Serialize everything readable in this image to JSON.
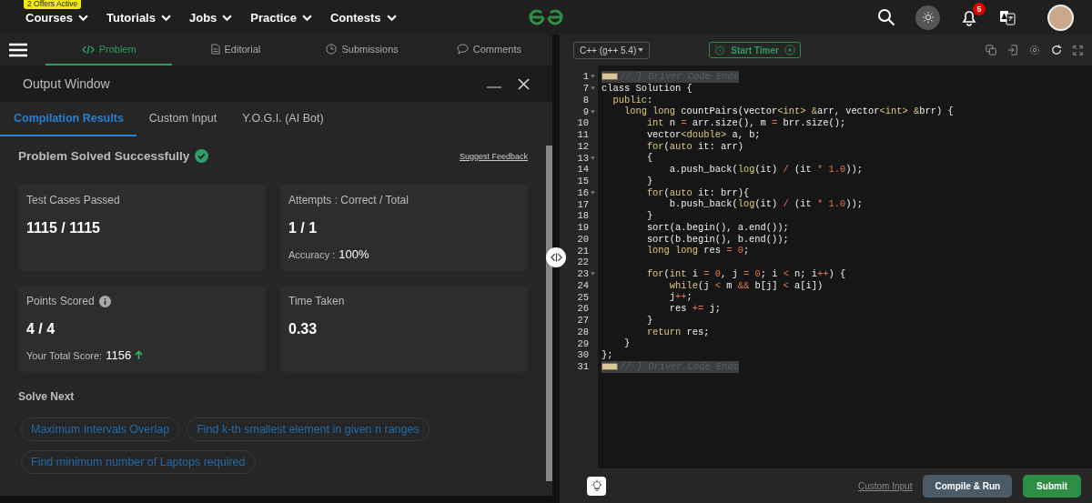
{
  "top_nav": {
    "menus": [
      {
        "label": "Courses",
        "badge": "2 Offers Active"
      },
      {
        "label": "Tutorials"
      },
      {
        "label": "Jobs"
      },
      {
        "label": "Practice"
      },
      {
        "label": "Contests"
      }
    ],
    "notification_count": "5"
  },
  "problem_tabs": [
    {
      "label": "Problem",
      "selected": true
    },
    {
      "label": "Editorial",
      "selected": false
    },
    {
      "label": "Submissions",
      "selected": false
    },
    {
      "label": "Comments",
      "selected": false
    }
  ],
  "output_window": {
    "title": "Output Window",
    "tabs": [
      {
        "label": "Compilation Results",
        "selected": true
      },
      {
        "label": "Custom Input",
        "selected": false
      },
      {
        "label": "Y.O.G.I. (AI Bot)",
        "selected": false
      }
    ],
    "status": "Problem Solved Successfully",
    "feedback_link": "Suggest Feedback",
    "cards": [
      {
        "label": "Test Cases Passed",
        "value": "1115 / 1115"
      },
      {
        "label": "Attempts : Correct / Total",
        "value": "1 / 1",
        "extra_label": "Accuracy :",
        "extra_value": "100%"
      },
      {
        "label": "Points Scored",
        "value": "4 / 4",
        "info": true,
        "extra_label": "Your Total Score:",
        "extra_value": "1156",
        "trend_up": true
      },
      {
        "label": "Time Taken",
        "value": "0.33"
      }
    ],
    "solve_next_title": "Solve Next",
    "solve_next": [
      "Maximum Intervals Overlap",
      "Find k-th smallest element in given n ranges",
      "Find minimum number of Laptops required"
    ]
  },
  "editor": {
    "language": "C++ (g++ 5.4)",
    "timer_button": "Start Timer",
    "lines": [
      {
        "number": "1",
        "kind": "folded",
        "foldable": true,
        "tokens": [
          {
            "kind": "comment",
            "text": "// } Driver Code Ends"
          }
        ]
      },
      {
        "number": "7",
        "kind": "code",
        "foldable": true,
        "tokens": [
          {
            "kind": "plain",
            "text": "class Solution {"
          }
        ]
      },
      {
        "number": "8",
        "kind": "code",
        "foldable": false,
        "tokens": [
          {
            "kind": "keyword",
            "text": "  public"
          },
          {
            "kind": "plain",
            "text": ":"
          }
        ]
      },
      {
        "number": "9",
        "kind": "code",
        "foldable": true,
        "tokens": [
          {
            "kind": "keyword",
            "text": "    long long"
          },
          {
            "kind": "plain",
            "text": " countPairs(vector"
          },
          {
            "kind": "keyword",
            "text": "<int> &"
          },
          {
            "kind": "plain",
            "text": "arr, vector"
          },
          {
            "kind": "keyword",
            "text": "<int> &"
          },
          {
            "kind": "plain",
            "text": "brr) {"
          }
        ]
      },
      {
        "number": "10",
        "kind": "code",
        "foldable": false,
        "tokens": [
          {
            "kind": "keyword",
            "text": "        int"
          },
          {
            "kind": "plain",
            "text": " n "
          },
          {
            "kind": "operator",
            "text": "="
          },
          {
            "kind": "plain",
            "text": " arr.size(), m "
          },
          {
            "kind": "operator",
            "text": "="
          },
          {
            "kind": "plain",
            "text": " brr.size();"
          }
        ]
      },
      {
        "number": "11",
        "kind": "code",
        "foldable": false,
        "tokens": [
          {
            "kind": "plain",
            "text": "        vector"
          },
          {
            "kind": "keyword",
            "text": "<double>"
          },
          {
            "kind": "plain",
            "text": " a, b;"
          }
        ]
      },
      {
        "number": "12",
        "kind": "code",
        "foldable": false,
        "tokens": [
          {
            "kind": "keyword",
            "text": "        for"
          },
          {
            "kind": "plain",
            "text": "("
          },
          {
            "kind": "keyword",
            "text": "auto"
          },
          {
            "kind": "plain",
            "text": " it: arr)"
          }
        ]
      },
      {
        "number": "13",
        "kind": "code",
        "foldable": true,
        "tokens": [
          {
            "kind": "plain",
            "text": "        {"
          }
        ]
      },
      {
        "number": "14",
        "kind": "code",
        "foldable": false,
        "tokens": [
          {
            "kind": "plain",
            "text": "            a.push_back("
          },
          {
            "kind": "keyword",
            "text": "log"
          },
          {
            "kind": "plain",
            "text": "(it) "
          },
          {
            "kind": "operator",
            "text": "/"
          },
          {
            "kind": "plain",
            "text": " (it "
          },
          {
            "kind": "operator",
            "text": "* 1.0"
          },
          {
            "kind": "plain",
            "text": "));"
          }
        ]
      },
      {
        "number": "15",
        "kind": "code",
        "foldable": false,
        "tokens": [
          {
            "kind": "plain",
            "text": "        }"
          }
        ]
      },
      {
        "number": "16",
        "kind": "code",
        "foldable": true,
        "tokens": [
          {
            "kind": "keyword",
            "text": "        for"
          },
          {
            "kind": "plain",
            "text": "("
          },
          {
            "kind": "keyword",
            "text": "auto"
          },
          {
            "kind": "plain",
            "text": " it: brr){"
          }
        ]
      },
      {
        "number": "17",
        "kind": "code",
        "foldable": false,
        "tokens": [
          {
            "kind": "plain",
            "text": "            b.push_back("
          },
          {
            "kind": "keyword",
            "text": "log"
          },
          {
            "kind": "plain",
            "text": "(it) "
          },
          {
            "kind": "operator",
            "text": "/"
          },
          {
            "kind": "plain",
            "text": " (it "
          },
          {
            "kind": "operator",
            "text": "* 1.0"
          },
          {
            "kind": "plain",
            "text": "));"
          }
        ]
      },
      {
        "number": "18",
        "kind": "code",
        "foldable": false,
        "tokens": [
          {
            "kind": "plain",
            "text": "        }"
          }
        ]
      },
      {
        "number": "19",
        "kind": "code",
        "foldable": false,
        "tokens": [
          {
            "kind": "plain",
            "text": "        sort(a.begin(), a.end());"
          }
        ]
      },
      {
        "number": "20",
        "kind": "code",
        "foldable": false,
        "tokens": [
          {
            "kind": "plain",
            "text": "        sort(b.begin(), b.end());"
          }
        ]
      },
      {
        "number": "21",
        "kind": "code",
        "foldable": false,
        "tokens": [
          {
            "kind": "keyword",
            "text": "        long long"
          },
          {
            "kind": "plain",
            "text": " res "
          },
          {
            "kind": "operator",
            "text": "= 0"
          },
          {
            "kind": "plain",
            "text": ";"
          }
        ]
      },
      {
        "number": "22",
        "kind": "code",
        "foldable": false
      },
      {
        "number": "23",
        "kind": "code",
        "foldable": true,
        "tokens": [
          {
            "kind": "keyword",
            "text": "        for"
          },
          {
            "kind": "plain",
            "text": "("
          },
          {
            "kind": "keyword",
            "text": "int"
          },
          {
            "kind": "plain",
            "text": " i "
          },
          {
            "kind": "operator",
            "text": "= 0"
          },
          {
            "kind": "plain",
            "text": ", j "
          },
          {
            "kind": "operator",
            "text": "= 0"
          },
          {
            "kind": "plain",
            "text": "; i "
          },
          {
            "kind": "operator",
            "text": "<"
          },
          {
            "kind": "plain",
            "text": " n; i"
          },
          {
            "kind": "operator",
            "text": "++"
          },
          {
            "kind": "plain",
            "text": ") {"
          }
        ]
      },
      {
        "number": "24",
        "kind": "code",
        "foldable": false,
        "tokens": [
          {
            "kind": "keyword",
            "text": "            while"
          },
          {
            "kind": "plain",
            "text": "(j "
          },
          {
            "kind": "operator",
            "text": "<"
          },
          {
            "kind": "plain",
            "text": " m "
          },
          {
            "kind": "operator",
            "text": "&&"
          },
          {
            "kind": "plain",
            "text": " b[j] "
          },
          {
            "kind": "operator",
            "text": "<"
          },
          {
            "kind": "plain",
            "text": " a[i])"
          }
        ]
      },
      {
        "number": "25",
        "kind": "code",
        "foldable": false,
        "tokens": [
          {
            "kind": "plain",
            "text": "            j"
          },
          {
            "kind": "operator",
            "text": "++"
          },
          {
            "kind": "plain",
            "text": ";"
          }
        ]
      },
      {
        "number": "26",
        "kind": "code",
        "foldable": false,
        "tokens": [
          {
            "kind": "plain",
            "text": "            res "
          },
          {
            "kind": "operator",
            "text": "+="
          },
          {
            "kind": "plain",
            "text": " j;"
          }
        ]
      },
      {
        "number": "27",
        "kind": "code",
        "foldable": false,
        "tokens": [
          {
            "kind": "plain",
            "text": "        }"
          }
        ]
      },
      {
        "number": "28",
        "kind": "code",
        "foldable": false,
        "tokens": [
          {
            "kind": "keyword",
            "text": "        return"
          },
          {
            "kind": "plain",
            "text": " res;"
          }
        ]
      },
      {
        "number": "29",
        "kind": "code",
        "foldable": false,
        "tokens": [
          {
            "kind": "plain",
            "text": "    }"
          }
        ]
      },
      {
        "number": "30",
        "kind": "code",
        "foldable": false,
        "tokens": [
          {
            "kind": "plain",
            "text": "};"
          }
        ]
      },
      {
        "number": "31",
        "kind": "folded",
        "foldable": false,
        "tokens": [
          {
            "kind": "comment",
            "text": "// } Driver Code Ends"
          }
        ]
      }
    ],
    "custom_input_link": "Custom Input",
    "compile_button": "Compile & Run",
    "submit_button": "Submit"
  }
}
